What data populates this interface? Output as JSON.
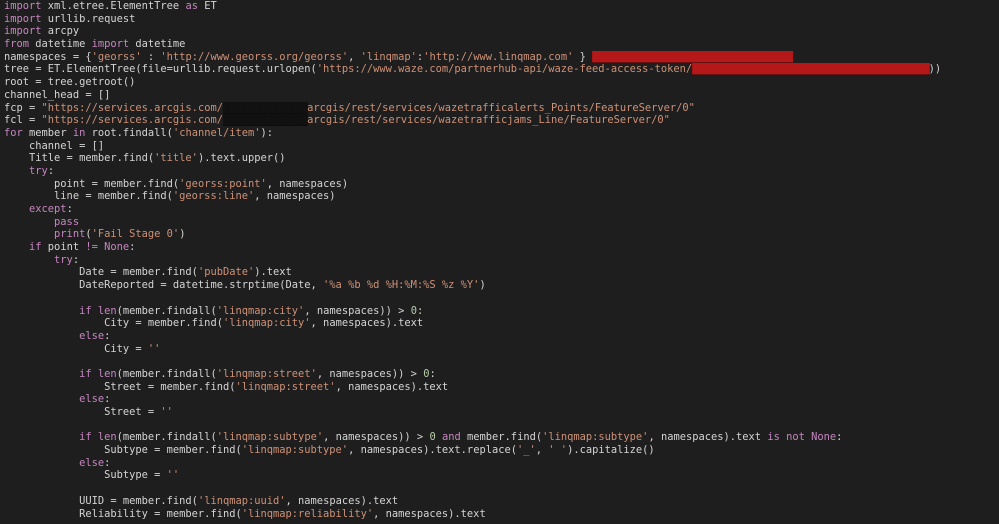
{
  "colors": {
    "background": "#1e1e1e",
    "text": "#d4d4d4",
    "keyword": "#c586c0",
    "string": "#ce9178",
    "number": "#b5cea8",
    "redaction": "#0a0a0a",
    "redaction_scribble": "#b51818"
  },
  "code": {
    "lines": [
      [
        {
          "t": "kw",
          "v": "import"
        },
        {
          "t": "text",
          "v": " xml.etree.ElementTree "
        },
        {
          "t": "kw",
          "v": "as"
        },
        {
          "t": "text",
          "v": " ET"
        }
      ],
      [
        {
          "t": "kw",
          "v": "import"
        },
        {
          "t": "text",
          "v": " urllib.request"
        }
      ],
      [
        {
          "t": "kw",
          "v": "import"
        },
        {
          "t": "text",
          "v": " arcpy"
        }
      ],
      [
        {
          "t": "kw",
          "v": "from"
        },
        {
          "t": "text",
          "v": " datetime "
        },
        {
          "t": "kw",
          "v": "import"
        },
        {
          "t": "text",
          "v": " datetime"
        }
      ],
      [
        {
          "t": "text",
          "v": "namespaces = {"
        },
        {
          "t": "str",
          "v": "'georss'"
        },
        {
          "t": "text",
          "v": " : "
        },
        {
          "t": "str",
          "v": "'http://www.georss.org/georss'"
        },
        {
          "t": "text",
          "v": ", "
        },
        {
          "t": "str",
          "v": "'linqmap'"
        },
        {
          "t": "text",
          "v": ":"
        },
        {
          "t": "str",
          "v": "'http://www.linqmap.com'"
        },
        {
          "t": "text",
          "v": " } "
        },
        {
          "t": "redact-red",
          "v": "██████████████████████████████████████"
        }
      ],
      [
        {
          "t": "text",
          "v": "tree = ET.ElementTree(file=urllib.request.urlopen("
        },
        {
          "t": "str",
          "v": "'https://www.waze.com/partnerhub-api/waze-feed-access-token/"
        },
        {
          "t": "redact-red",
          "v": "█████████████████████████████████████████████"
        },
        {
          "t": "text",
          "v": "))"
        }
      ],
      [
        {
          "t": "text",
          "v": "root = tree.getroot()"
        }
      ],
      [
        {
          "t": "text",
          "v": "channel_head = []"
        }
      ],
      [
        {
          "t": "text",
          "v": "fcp = "
        },
        {
          "t": "str",
          "v": "\"https://services.arcgis.com/"
        },
        {
          "t": "redact",
          "v": "████████████████"
        },
        {
          "t": "str",
          "v": "arcgis/rest/services/wazetrafficalerts_Points/FeatureServer/0\""
        }
      ],
      [
        {
          "t": "text",
          "v": "fcl = "
        },
        {
          "t": "str",
          "v": "\"https://services.arcgis.com/"
        },
        {
          "t": "redact",
          "v": "████████████████"
        },
        {
          "t": "str",
          "v": "arcgis/rest/services/wazetrafficjams_Line/FeatureServer/0\""
        }
      ],
      [
        {
          "t": "kw",
          "v": "for"
        },
        {
          "t": "text",
          "v": " member "
        },
        {
          "t": "kw",
          "v": "in"
        },
        {
          "t": "text",
          "v": " root.findall("
        },
        {
          "t": "str",
          "v": "'channel/item'"
        },
        {
          "t": "text",
          "v": "):"
        }
      ],
      [
        {
          "t": "text",
          "v": "    channel = []"
        }
      ],
      [
        {
          "t": "text",
          "v": "    Title = member.find("
        },
        {
          "t": "str",
          "v": "'title'"
        },
        {
          "t": "text",
          "v": ").text.upper()"
        }
      ],
      [
        {
          "t": "text",
          "v": "    "
        },
        {
          "t": "kw",
          "v": "try"
        },
        {
          "t": "text",
          "v": ":"
        }
      ],
      [
        {
          "t": "text",
          "v": "        point = member.find("
        },
        {
          "t": "str",
          "v": "'georss:point'"
        },
        {
          "t": "text",
          "v": ", namespaces)"
        }
      ],
      [
        {
          "t": "text",
          "v": "        line = member.find("
        },
        {
          "t": "str",
          "v": "'georss:line'"
        },
        {
          "t": "text",
          "v": ", namespaces)"
        }
      ],
      [
        {
          "t": "text",
          "v": "    "
        },
        {
          "t": "kw",
          "v": "except"
        },
        {
          "t": "text",
          "v": ":"
        }
      ],
      [
        {
          "t": "text",
          "v": "        "
        },
        {
          "t": "kw",
          "v": "pass"
        }
      ],
      [
        {
          "t": "text",
          "v": "        "
        },
        {
          "t": "kw",
          "v": "print"
        },
        {
          "t": "text",
          "v": "("
        },
        {
          "t": "str",
          "v": "'Fail Stage 0'"
        },
        {
          "t": "text",
          "v": ")"
        }
      ],
      [
        {
          "t": "text",
          "v": "    "
        },
        {
          "t": "kw",
          "v": "if"
        },
        {
          "t": "text",
          "v": " point "
        },
        {
          "t": "kw",
          "v": "!="
        },
        {
          "t": "text",
          "v": " "
        },
        {
          "t": "kw",
          "v": "None"
        },
        {
          "t": "text",
          "v": ":"
        }
      ],
      [
        {
          "t": "text",
          "v": "        "
        },
        {
          "t": "kw",
          "v": "try"
        },
        {
          "t": "text",
          "v": ":"
        }
      ],
      [
        {
          "t": "text",
          "v": "            Date = member.find("
        },
        {
          "t": "str",
          "v": "'pubDate'"
        },
        {
          "t": "text",
          "v": ").text"
        }
      ],
      [
        {
          "t": "text",
          "v": "            DateReported = datetime.strptime(Date, "
        },
        {
          "t": "str",
          "v": "'%a %b %d %H:%M:%S %z %Y'"
        },
        {
          "t": "text",
          "v": ")"
        }
      ],
      [],
      [
        {
          "t": "text",
          "v": "            "
        },
        {
          "t": "kw",
          "v": "if"
        },
        {
          "t": "text",
          "v": " "
        },
        {
          "t": "kw",
          "v": "len"
        },
        {
          "t": "text",
          "v": "(member.findall("
        },
        {
          "t": "str",
          "v": "'linqmap:city'"
        },
        {
          "t": "text",
          "v": ", namespaces)) > "
        },
        {
          "t": "num",
          "v": "0"
        },
        {
          "t": "text",
          "v": ":"
        }
      ],
      [
        {
          "t": "text",
          "v": "                City = member.find("
        },
        {
          "t": "str",
          "v": "'linqmap:city'"
        },
        {
          "t": "text",
          "v": ", namespaces).text"
        }
      ],
      [
        {
          "t": "text",
          "v": "            "
        },
        {
          "t": "kw",
          "v": "else"
        },
        {
          "t": "text",
          "v": ":"
        }
      ],
      [
        {
          "t": "text",
          "v": "                City = "
        },
        {
          "t": "str",
          "v": "''"
        }
      ],
      [],
      [
        {
          "t": "text",
          "v": "            "
        },
        {
          "t": "kw",
          "v": "if"
        },
        {
          "t": "text",
          "v": " "
        },
        {
          "t": "kw",
          "v": "len"
        },
        {
          "t": "text",
          "v": "(member.findall("
        },
        {
          "t": "str",
          "v": "'linqmap:street'"
        },
        {
          "t": "text",
          "v": ", namespaces)) > "
        },
        {
          "t": "num",
          "v": "0"
        },
        {
          "t": "text",
          "v": ":"
        }
      ],
      [
        {
          "t": "text",
          "v": "                Street = member.find("
        },
        {
          "t": "str",
          "v": "'linqmap:street'"
        },
        {
          "t": "text",
          "v": ", namespaces).text"
        }
      ],
      [
        {
          "t": "text",
          "v": "            "
        },
        {
          "t": "kw",
          "v": "else"
        },
        {
          "t": "text",
          "v": ":"
        }
      ],
      [
        {
          "t": "text",
          "v": "                Street = "
        },
        {
          "t": "str",
          "v": "''"
        }
      ],
      [],
      [
        {
          "t": "text",
          "v": "            "
        },
        {
          "t": "kw",
          "v": "if"
        },
        {
          "t": "text",
          "v": " "
        },
        {
          "t": "kw",
          "v": "len"
        },
        {
          "t": "text",
          "v": "(member.findall("
        },
        {
          "t": "str",
          "v": "'linqmap:subtype'"
        },
        {
          "t": "text",
          "v": ", namespaces)) > "
        },
        {
          "t": "num",
          "v": "0"
        },
        {
          "t": "text",
          "v": " "
        },
        {
          "t": "kw",
          "v": "and"
        },
        {
          "t": "text",
          "v": " member.find("
        },
        {
          "t": "str",
          "v": "'linqmap:subtype'"
        },
        {
          "t": "text",
          "v": ", namespaces).text "
        },
        {
          "t": "kw",
          "v": "is not None"
        },
        {
          "t": "text",
          "v": ":"
        }
      ],
      [
        {
          "t": "text",
          "v": "                Subtype = member.find("
        },
        {
          "t": "str",
          "v": "'linqmap:subtype'"
        },
        {
          "t": "text",
          "v": ", namespaces).text.replace("
        },
        {
          "t": "str",
          "v": "'_'"
        },
        {
          "t": "text",
          "v": ", "
        },
        {
          "t": "str",
          "v": "' '"
        },
        {
          "t": "text",
          "v": ").capitalize()"
        }
      ],
      [
        {
          "t": "text",
          "v": "            "
        },
        {
          "t": "kw",
          "v": "else"
        },
        {
          "t": "text",
          "v": ":"
        }
      ],
      [
        {
          "t": "text",
          "v": "                Subtype = "
        },
        {
          "t": "str",
          "v": "''"
        }
      ],
      [],
      [
        {
          "t": "text",
          "v": "            UUID = member.find("
        },
        {
          "t": "str",
          "v": "'linqmap:uuid'"
        },
        {
          "t": "text",
          "v": ", namespaces).text"
        }
      ],
      [
        {
          "t": "text",
          "v": "            Reliability = member.find("
        },
        {
          "t": "str",
          "v": "'linqmap:reliability'"
        },
        {
          "t": "text",
          "v": ", namespaces).text"
        }
      ]
    ]
  }
}
